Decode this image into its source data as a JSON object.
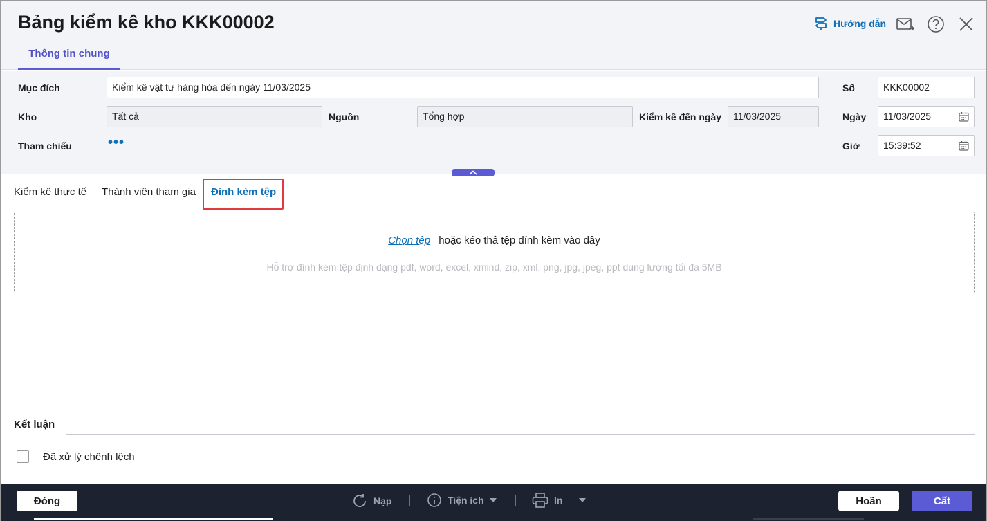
{
  "header": {
    "title": "Bảng kiểm kê kho KKK00002",
    "guide_label": "Hướng dẫn",
    "tab_general": "Thông tin chung"
  },
  "form": {
    "purpose_label": "Mục đích",
    "purpose_value": "Kiểm kê vật tư hàng hóa đến ngày 11/03/2025",
    "warehouse_label": "Kho",
    "warehouse_value": "Tất cả",
    "source_label": "Nguồn",
    "source_value": "Tổng hợp",
    "inventory_date_label": "Kiểm kê đến ngày",
    "inventory_date_value": "11/03/2025",
    "reference_label": "Tham chiếu",
    "number_label": "Số",
    "number_value": "KKK00002",
    "date_label": "Ngày",
    "date_value": "11/03/2025",
    "time_label": "Giờ",
    "time_value": "15:39:52"
  },
  "subtabs": [
    {
      "label": "Kiểm kê thực tế",
      "active": false
    },
    {
      "label": "Thành viên tham gia",
      "active": false
    },
    {
      "label": "Đính kèm tệp",
      "active": true
    }
  ],
  "dropzone": {
    "choose_file": "Chọn tệp",
    "drag_text": "hoặc kéo thả tệp đính kèm vào đây",
    "support_text": "Hỗ trợ đính kèm tệp định dạng pdf, word, excel, xmind, zip, xml, png, jpg, jpeg, ppt dung lượng tối đa 5MB"
  },
  "conclusion": {
    "label": "Kết luận",
    "value": "",
    "checkbox_label": "Đã xử lý chênh lệch",
    "checked": false
  },
  "footer": {
    "close_label": "Đóng",
    "reload_label": "Nạp",
    "utilities_label": "Tiện ích",
    "print_label": "In",
    "done_label": "Hoãn",
    "save_label": "Cất"
  },
  "colors": {
    "accent": "#5b5bd6",
    "link": "#0d6fb8",
    "highlight": "#e0393e",
    "footer_bg": "#1d2231"
  }
}
